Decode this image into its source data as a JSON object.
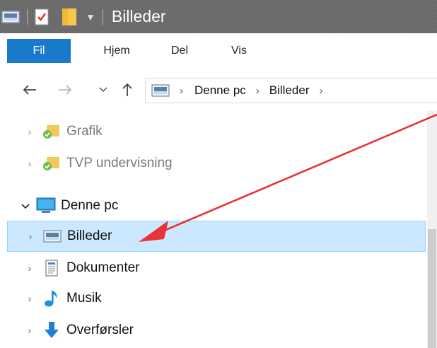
{
  "titlebar": {
    "title": "Billeder",
    "icons": [
      "pictures-folder-icon",
      "properties-icon",
      "new-folder-icon",
      "customize-quick-access-icon"
    ]
  },
  "ribbon": {
    "tabs": [
      {
        "label": "Fil",
        "active": true
      },
      {
        "label": "Hjem"
      },
      {
        "label": "Del"
      },
      {
        "label": "Vis"
      }
    ],
    "active_color": "#1979ca"
  },
  "addressbar": {
    "back_icon": "arrow-left-icon",
    "forward_icon": "arrow-right-icon",
    "recent_icon": "chevron-down-icon",
    "up_icon": "arrow-up-icon",
    "crumbs": [
      "Denne pc",
      "Billeder"
    ]
  },
  "navpane": {
    "items": [
      {
        "label": "Grafik",
        "icon": "folder-sync-icon",
        "faded": true
      },
      {
        "label": "TVP undervisning",
        "icon": "folder-sync-icon",
        "faded": true
      },
      {
        "label": "Denne pc",
        "icon": "computer-icon",
        "expanded": true
      },
      {
        "label": "Billeder",
        "icon": "pictures-icon",
        "selected": true
      },
      {
        "label": "Dokumenter",
        "icon": "documents-icon"
      },
      {
        "label": "Musik",
        "icon": "music-icon"
      },
      {
        "label": "Overførsler",
        "icon": "downloads-icon"
      }
    ],
    "selected_bg": "#cce8ff"
  },
  "annotation": {
    "arrow_color": "#e8333a"
  }
}
